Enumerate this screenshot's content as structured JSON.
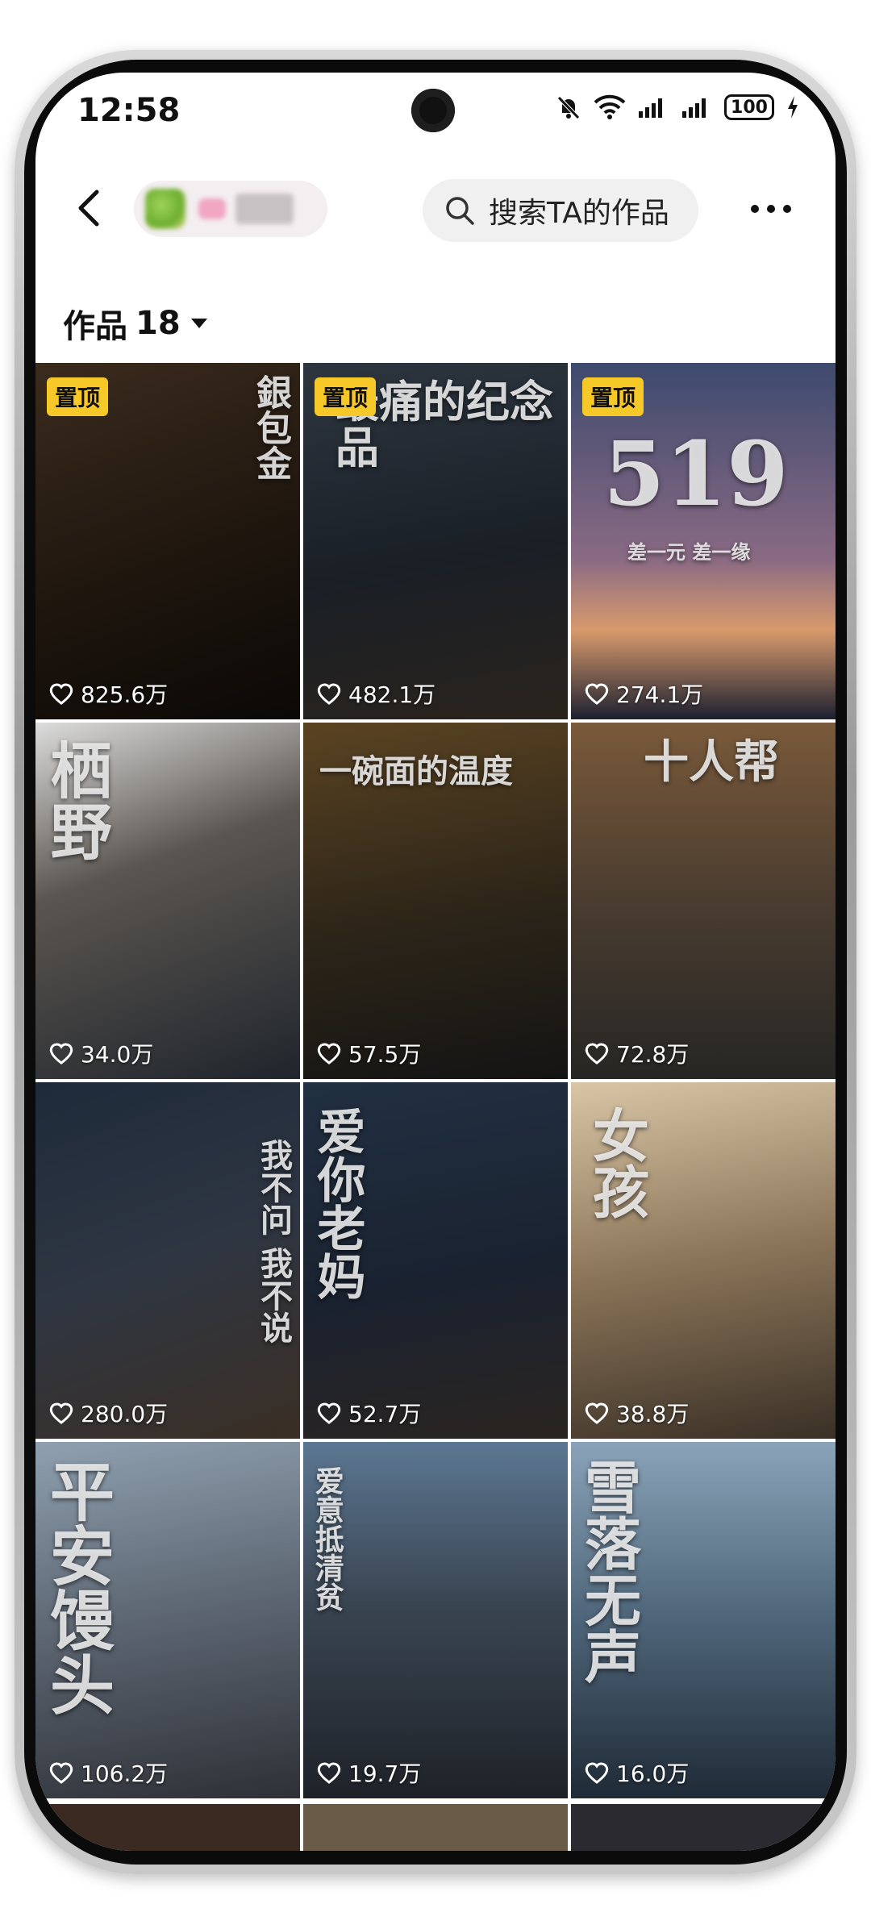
{
  "status_bar": {
    "time": "12:58",
    "battery": "100"
  },
  "header": {
    "search_placeholder": "搜索TA的作品"
  },
  "works": {
    "label": "作品",
    "count": "18"
  },
  "pin_label": "置顶",
  "items": [
    {
      "title": "銀包金",
      "likes": "825.6万",
      "pinned": true,
      "bg": "linear-gradient(160deg,#3a2b1d,#1c140d 60%,#0b0806)"
    },
    {
      "title": "最痛的纪念品",
      "likes": "482.1万",
      "pinned": true,
      "bg": "linear-gradient(170deg,#2d3640,#1a1f26 55%,#2a231d)"
    },
    {
      "title": "519",
      "subtitle": "差一元 差一缘",
      "likes": "274.1万",
      "pinned": true,
      "bg": "linear-gradient(180deg,#3d4a6e,#8a6a84 55%,#d89a6c 75%,#1c2030)"
    },
    {
      "title": "栖野",
      "likes": "34.0万",
      "pinned": false,
      "bg": "linear-gradient(160deg,#dcdcdc,#5a5550 40%,#20252c)"
    },
    {
      "title": "一碗面的温度",
      "likes": "57.5万",
      "pinned": false,
      "bg": "linear-gradient(170deg,#5a4322,#2c2418 55%,#141414)"
    },
    {
      "title": "十人帮",
      "likes": "72.8万",
      "pinned": false,
      "bg": "linear-gradient(180deg,#7a5a3a,#4a3c30 50%,#262624)"
    },
    {
      "title": "我不问 我不说",
      "likes": "280.0万",
      "pinned": false,
      "bg": "linear-gradient(160deg,#1e2a3a,#2f3642 50%,#3a2e24)"
    },
    {
      "title": "爱你老妈",
      "likes": "52.7万",
      "pinned": false,
      "bg": "linear-gradient(170deg,#213042,#1a2230 55%,#2a2420)"
    },
    {
      "title": "女孩",
      "likes": "38.8万",
      "pinned": false,
      "bg": "linear-gradient(170deg,#d9c6a6,#8a7458 50%,#3a3026)"
    },
    {
      "title": "平安馒头",
      "likes": "106.2万",
      "pinned": false,
      "bg": "linear-gradient(170deg,#8fa0b0,#5b6470 50%,#2e3036)"
    },
    {
      "title": "爱意抵清贫",
      "likes": "19.7万",
      "pinned": false,
      "bg": "linear-gradient(180deg,#5c7792,#3a4552 45%,#1e2228)"
    },
    {
      "title": "雪落无声",
      "likes": "16.0万",
      "pinned": false,
      "bg": "linear-gradient(180deg,#8aa3b8,#4e6579 50%,#1f2a36)"
    }
  ],
  "partial_row": [
    "#3a2a22",
    "#6a5a48",
    "#2a2a30"
  ]
}
